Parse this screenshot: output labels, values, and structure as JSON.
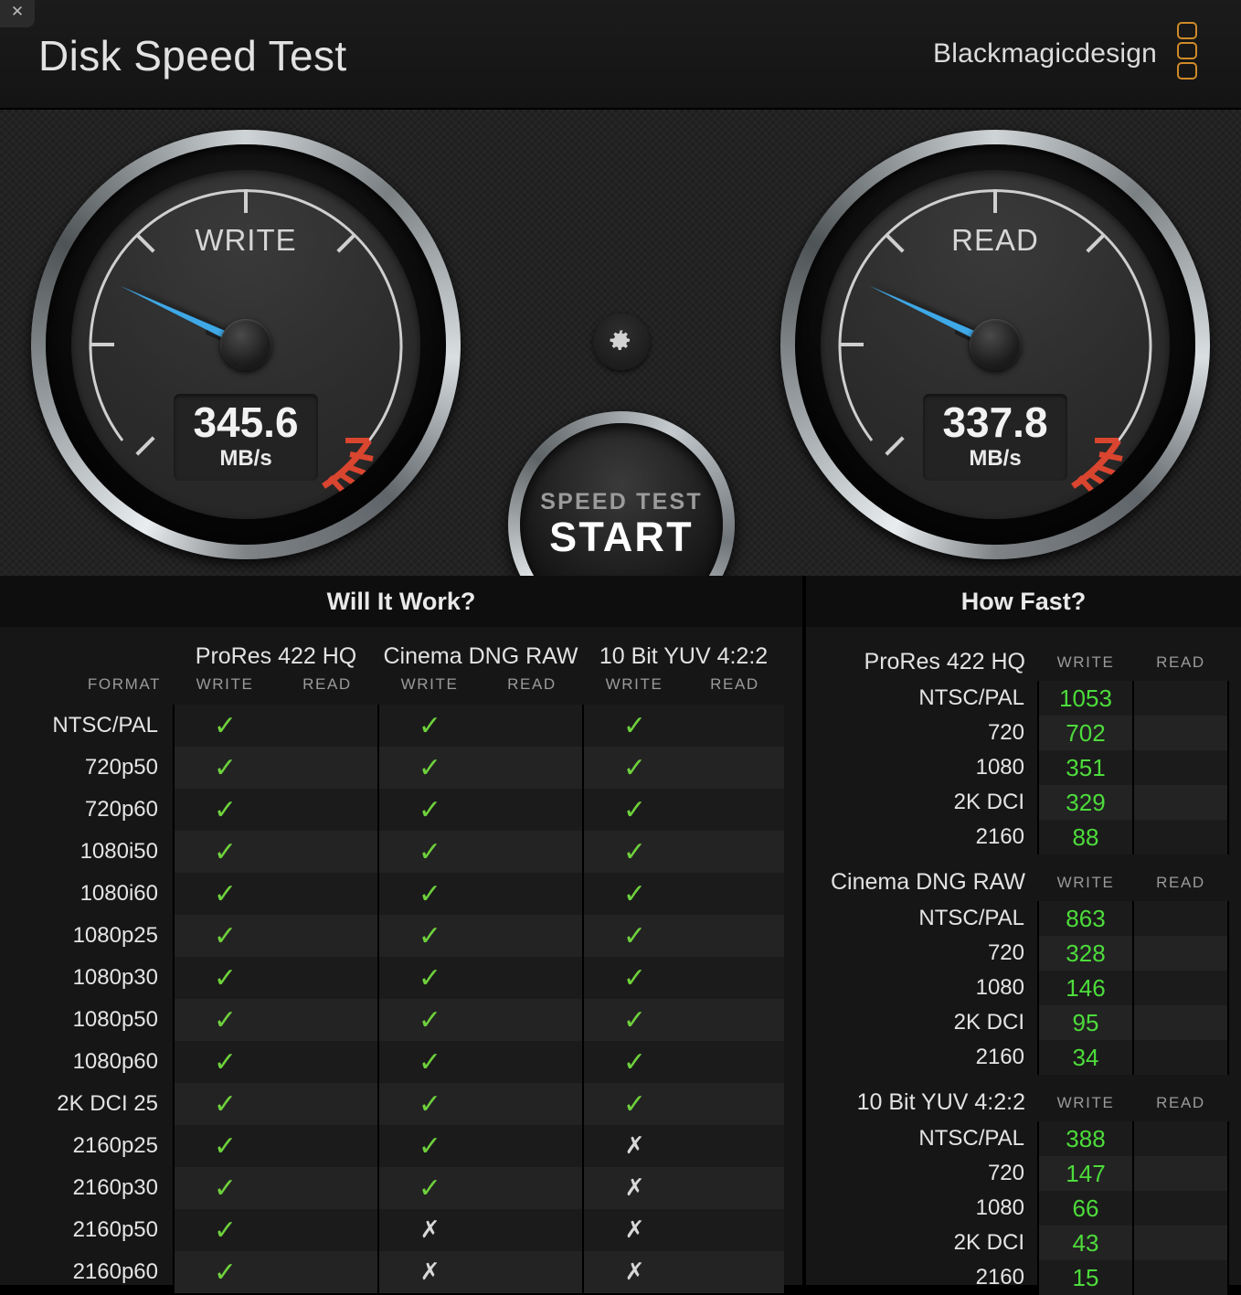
{
  "window": {
    "title": "Disk Speed Test",
    "close_label": "✕",
    "brand": "Blackmagicdesign"
  },
  "gauges": {
    "write": {
      "label": "WRITE",
      "value": "345.6",
      "unit": "MB/s"
    },
    "read": {
      "label": "READ",
      "value": "337.8",
      "unit": "MB/s"
    }
  },
  "controls": {
    "gear_icon": "gear-icon",
    "start_top": "SPEED TEST",
    "start_bottom": "START"
  },
  "will_it_work": {
    "title": "Will It Work?",
    "format_header": "FORMAT",
    "codecs": [
      "ProRes 422 HQ",
      "Cinema DNG RAW",
      "10 Bit YUV 4:2:2"
    ],
    "sub_headers": [
      "WRITE",
      "READ"
    ],
    "ok_glyph": "✓",
    "no_glyph": "✗",
    "rows": [
      {
        "format": "NTSC/PAL",
        "cells": [
          "ok",
          "",
          "ok",
          "",
          "ok",
          ""
        ]
      },
      {
        "format": "720p50",
        "cells": [
          "ok",
          "",
          "ok",
          "",
          "ok",
          ""
        ]
      },
      {
        "format": "720p60",
        "cells": [
          "ok",
          "",
          "ok",
          "",
          "ok",
          ""
        ]
      },
      {
        "format": "1080i50",
        "cells": [
          "ok",
          "",
          "ok",
          "",
          "ok",
          ""
        ]
      },
      {
        "format": "1080i60",
        "cells": [
          "ok",
          "",
          "ok",
          "",
          "ok",
          ""
        ]
      },
      {
        "format": "1080p25",
        "cells": [
          "ok",
          "",
          "ok",
          "",
          "ok",
          ""
        ]
      },
      {
        "format": "1080p30",
        "cells": [
          "ok",
          "",
          "ok",
          "",
          "ok",
          ""
        ]
      },
      {
        "format": "1080p50",
        "cells": [
          "ok",
          "",
          "ok",
          "",
          "ok",
          ""
        ]
      },
      {
        "format": "1080p60",
        "cells": [
          "ok",
          "",
          "ok",
          "",
          "ok",
          ""
        ]
      },
      {
        "format": "2K DCI 25",
        "cells": [
          "ok",
          "",
          "ok",
          "",
          "ok",
          ""
        ]
      },
      {
        "format": "2160p25",
        "cells": [
          "ok",
          "",
          "ok",
          "",
          "no",
          ""
        ]
      },
      {
        "format": "2160p30",
        "cells": [
          "ok",
          "",
          "ok",
          "",
          "no",
          ""
        ]
      },
      {
        "format": "2160p50",
        "cells": [
          "ok",
          "",
          "no",
          "",
          "no",
          ""
        ]
      },
      {
        "format": "2160p60",
        "cells": [
          "ok",
          "",
          "no",
          "",
          "no",
          ""
        ]
      }
    ]
  },
  "how_fast": {
    "title": "How Fast?",
    "sub_headers": [
      "WRITE",
      "READ"
    ],
    "groups": [
      {
        "name": "ProRes 422 HQ",
        "rows": [
          {
            "label": "NTSC/PAL",
            "write": "1053",
            "read": ""
          },
          {
            "label": "720",
            "write": "702",
            "read": ""
          },
          {
            "label": "1080",
            "write": "351",
            "read": ""
          },
          {
            "label": "2K DCI",
            "write": "329",
            "read": ""
          },
          {
            "label": "2160",
            "write": "88",
            "read": ""
          }
        ]
      },
      {
        "name": "Cinema DNG RAW",
        "rows": [
          {
            "label": "NTSC/PAL",
            "write": "863",
            "read": ""
          },
          {
            "label": "720",
            "write": "328",
            "read": ""
          },
          {
            "label": "1080",
            "write": "146",
            "read": ""
          },
          {
            "label": "2K DCI",
            "write": "95",
            "read": ""
          },
          {
            "label": "2160",
            "write": "34",
            "read": ""
          }
        ]
      },
      {
        "name": "10 Bit YUV 4:2:2",
        "rows": [
          {
            "label": "NTSC/PAL",
            "write": "388",
            "read": ""
          },
          {
            "label": "720",
            "write": "147",
            "read": ""
          },
          {
            "label": "1080",
            "write": "66",
            "read": ""
          },
          {
            "label": "2K DCI",
            "write": "43",
            "read": ""
          },
          {
            "label": "2160",
            "write": "15",
            "read": ""
          }
        ]
      }
    ]
  },
  "colors": {
    "accent_green": "#6ed13c",
    "value_green": "#4ddc3b",
    "needle_blue": "#3fa9e8",
    "danger_red": "#d9452f",
    "brand_orange": "#cf8a28"
  }
}
